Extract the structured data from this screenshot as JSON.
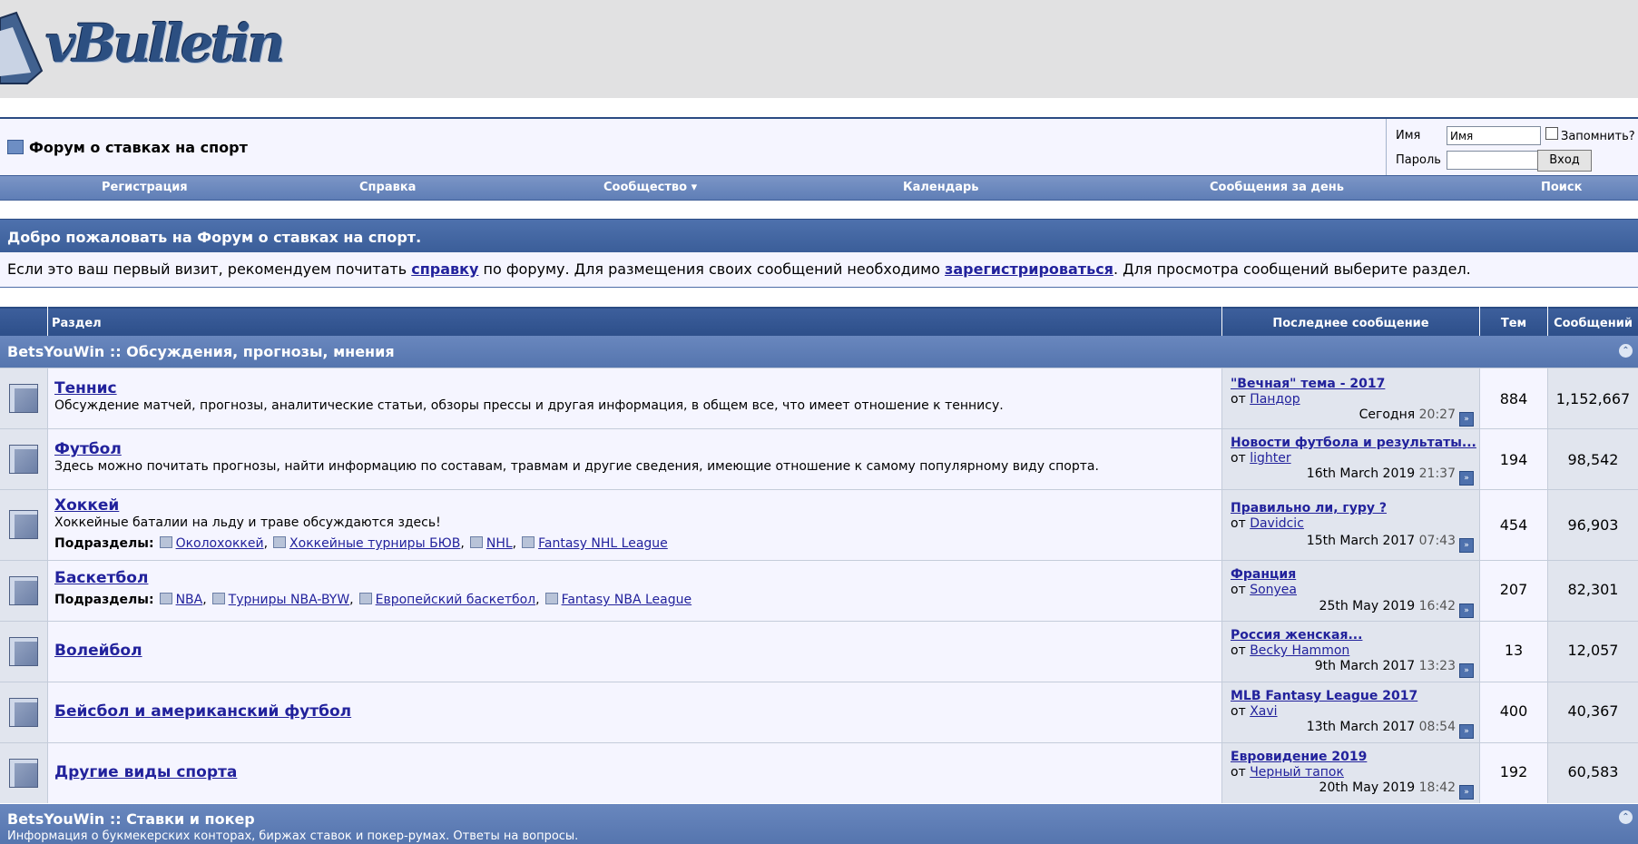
{
  "logo": {
    "text": "vBulletin"
  },
  "header": {
    "forum_title": "Форум о ставках на спорт",
    "login": {
      "username_label": "Имя",
      "username_value": "Имя",
      "password_label": "Пароль",
      "remember_label": "Запомнить?",
      "login_button": "Вход"
    }
  },
  "menu": {
    "items": [
      "Регистрация",
      "Справка",
      "Сообщество ▾",
      "Календарь",
      "Сообщения за день",
      "Поиск"
    ]
  },
  "welcome": {
    "title": "Добро пожаловать на Форум о ставках на спорт.",
    "text_1": "Если это ваш первый визит, рекомендуем почитать ",
    "link_1": "справку",
    "text_2": " по форуму. Для размещения своих сообщений необходимо ",
    "link_2": "зарегистрироваться",
    "text_3": ". Для просмотра сообщений выберите раздел."
  },
  "table": {
    "headers": {
      "forum": "Раздел",
      "last_post": "Последнее сообщение",
      "threads": "Тем",
      "posts": "Сообщений"
    },
    "category_1": {
      "title": "BetsYouWin :: Обсуждения, прогнозы, мнения",
      "collapse_icon": "collapse-icon"
    },
    "category_2": {
      "title": "BetsYouWin :: Ставки и покер",
      "desc": "Информация о букмекерских конторах, биржах ставок и покер-румах. Ответы на вопросы."
    },
    "by_prefix": "от",
    "subforums_label": "Подразделы:",
    "forums": [
      {
        "name": "Теннис",
        "desc": "Обсуждение матчей, прогнозы, аналитические статьи, обзоры прессы и другая информация, в общем все, что имеет отношение к теннису.",
        "subforums": [],
        "last_title": "\"Вечная\" тема - 2017",
        "last_by": "Пандор",
        "last_date": "Сегодня",
        "last_time": "20:27",
        "threads": "884",
        "posts": "1,152,667"
      },
      {
        "name": "Футбол",
        "desc": "Здесь можно почитать прогнозы, найти информацию по составам, травмам и другие сведения, имеющие отношение к самому популярному виду спорта.",
        "subforums": [],
        "last_title": "Новости футбола и результаты...",
        "last_by": "lighter",
        "last_date": "16th March 2019",
        "last_time": "21:37",
        "threads": "194",
        "posts": "98,542"
      },
      {
        "name": "Хоккей",
        "desc": "Хоккейные баталии на льду и траве обсуждаются здесь!",
        "subforums": [
          "Околохоккей",
          "Хоккейные турниры БЮВ",
          "NHL",
          "Fantasy NHL League"
        ],
        "last_title": "Правильно ли, гуру ?",
        "last_by": "Davidcic",
        "last_date": "15th March 2017",
        "last_time": "07:43",
        "threads": "454",
        "posts": "96,903"
      },
      {
        "name": "Баскетбол",
        "desc": "",
        "subforums": [
          "NBA",
          "Турниры NBA-BYW",
          "Европейский баскетбол",
          "Fantasy NBA League"
        ],
        "last_title": "Франция",
        "last_by": "Sonyea",
        "last_date": "25th May 2019",
        "last_time": "16:42",
        "threads": "207",
        "posts": "82,301"
      },
      {
        "name": "Волейбол",
        "desc": "",
        "subforums": [],
        "last_title": "Россия женская...",
        "last_by": "Becky Hammon",
        "last_date": "9th March 2017",
        "last_time": "13:23",
        "threads": "13",
        "posts": "12,057"
      },
      {
        "name": "Бейсбол и американский футбол",
        "desc": "",
        "subforums": [],
        "last_title": "MLB Fantasy League 2017",
        "last_by": "Xavi",
        "last_date": "13th March 2017",
        "last_time": "08:54",
        "threads": "400",
        "posts": "40,367"
      },
      {
        "name": "Другие виды спорта",
        "desc": "",
        "subforums": [],
        "last_title": "Евровидение 2019",
        "last_by": "Черный тапок",
        "last_date": "20th May 2019",
        "last_time": "18:42",
        "threads": "192",
        "posts": "60,583"
      }
    ]
  },
  "colors": {
    "header_blue": "#2d4f8a",
    "menu_blue": "#6a88bf",
    "row_light": "#f5f5ff",
    "row_alt": "#e1e5ee",
    "link": "#22229c"
  }
}
